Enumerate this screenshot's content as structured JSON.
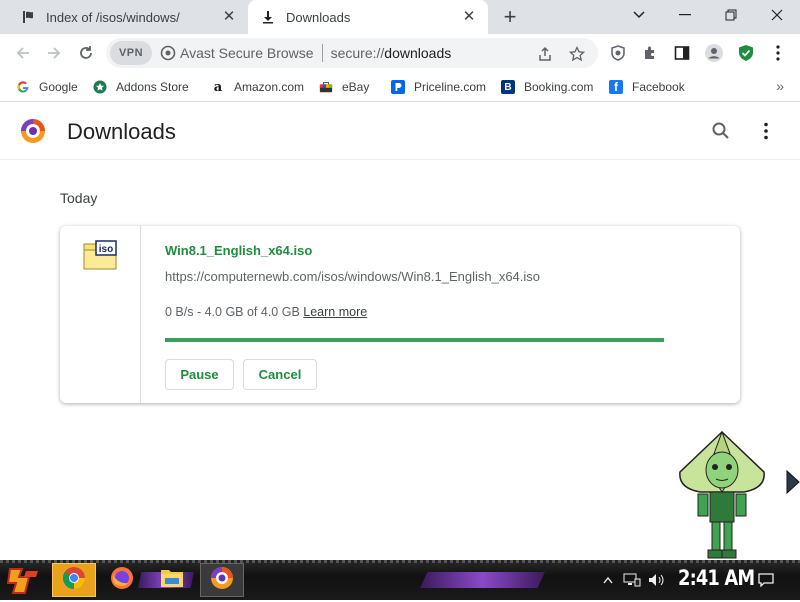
{
  "tabs": [
    {
      "title": "Index of /isos/windows/",
      "icon": "globe-icon"
    },
    {
      "title": "Downloads",
      "icon": "download-icon",
      "active": true
    }
  ],
  "omnibox": {
    "vpn_label": "VPN",
    "site_label": "Avast Secure Browse",
    "url_scheme": "secure://",
    "url_host": "downloads"
  },
  "bookmarks": [
    {
      "label": "Google",
      "icon": "google-icon"
    },
    {
      "label": "Addons Store",
      "icon": "addons-store-icon"
    },
    {
      "label": "Amazon.com",
      "icon": "amazon-icon"
    },
    {
      "label": "eBay",
      "icon": "ebay-icon"
    },
    {
      "label": "Priceline.com",
      "icon": "priceline-icon"
    },
    {
      "label": "Booking.com",
      "icon": "booking-icon"
    },
    {
      "label": "Facebook",
      "icon": "facebook-icon"
    }
  ],
  "page": {
    "title": "Downloads",
    "section_date": "Today"
  },
  "download": {
    "file_name": "Win8.1_English_x64.iso",
    "url": "https://computernewb.com/isos/windows/Win8.1_English_x64.iso",
    "status": "0 B/s - 4.0 GB of 4.0 GB",
    "learn_more": "Learn more",
    "progress_fraction": 1.0,
    "icon_label": "iso",
    "pause_label": "Pause",
    "cancel_label": "Cancel"
  },
  "taskbar": {
    "clock": "2:41 AM"
  },
  "colors": {
    "accent_green": "#1e8e3e",
    "progress_green": "#3a9f5a",
    "tab_strip": "#dee1e6",
    "taskbar_active": "#e8a21c"
  }
}
